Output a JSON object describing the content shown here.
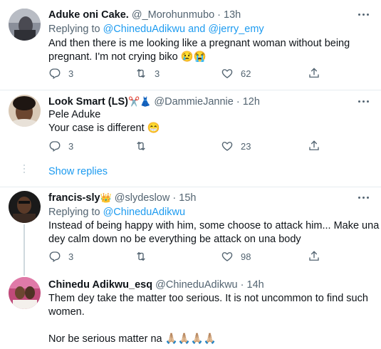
{
  "tweets": [
    {
      "name": "Aduke oni Cake.",
      "handle": "@_Morohunmubo",
      "time": "13h",
      "replying_prefix": "Replying to ",
      "replying_user1": "@ChineduAdikwu",
      "replying_and": " and ",
      "replying_user2": "@jerry_emy",
      "lines": [
        "And then there is me looking like a pregnant woman without being",
        "pregnant. I'm not crying biko 😢😭"
      ],
      "replies": "3",
      "retweets": "3",
      "likes": "62"
    },
    {
      "name": "Look Smart (LS)",
      "name_emoji": "✂️👗",
      "handle": "@DammieJannie",
      "time": "12h",
      "lines": [
        "Pele Aduke",
        "Your case is different 😁"
      ],
      "replies": "3",
      "retweets": "",
      "likes": "23"
    },
    {
      "name": "francis-sly",
      "name_emoji": "👑",
      "handle": "@slydeslow",
      "time": "15h",
      "replying_prefix": "Replying to ",
      "replying_user1": "@ChineduAdikwu",
      "lines": [
        "Instead of being happy with him, some choose to attack him... Make una",
        "dey calm down no be everything be attack on una body"
      ],
      "replies": "3",
      "retweets": "",
      "likes": "98"
    },
    {
      "name": "Chinedu Adikwu_esq",
      "handle": "@ChineduAdikwu",
      "time": "14h",
      "lines": [
        "Them dey take the matter too serious. It is not uncommon to find such",
        "women.",
        "",
        "Nor be serious matter na 🙏🏼🙏🏼🙏🏼🙏🏼"
      ]
    }
  ],
  "show_replies": "Show replies",
  "icons": [
    "more-icon",
    "reply-icon",
    "retweet-icon",
    "like-icon",
    "share-icon"
  ],
  "colors": {
    "link": "#1d9bf0",
    "secondary": "#536471",
    "divider": "#e6ecf0"
  }
}
